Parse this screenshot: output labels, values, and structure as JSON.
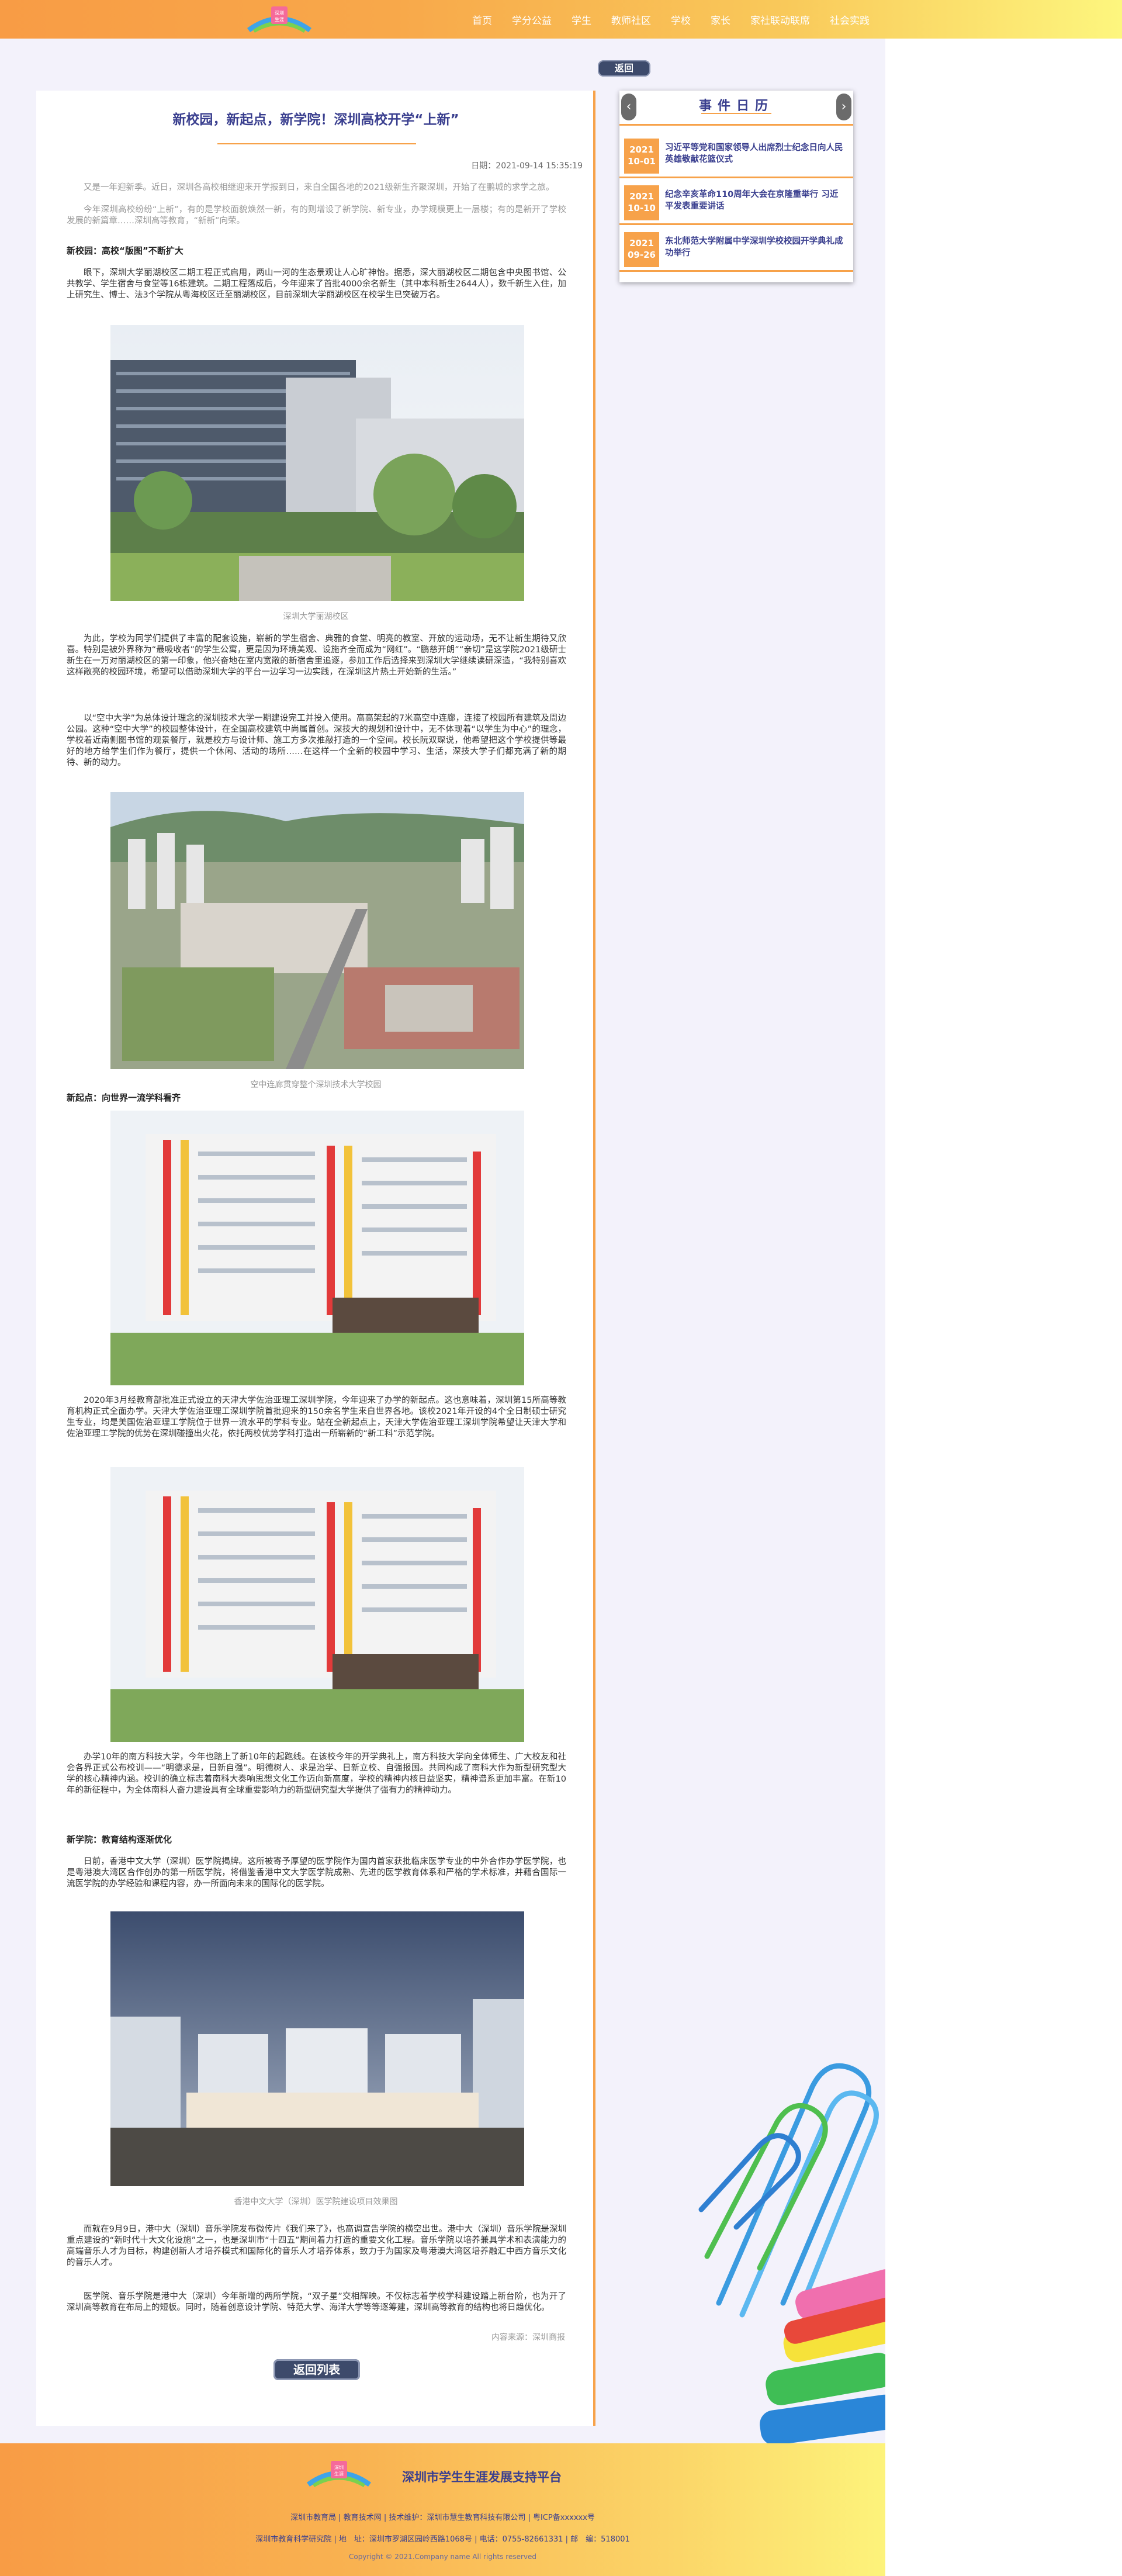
{
  "header": {
    "nav": [
      "首页",
      "学分公益",
      "学生",
      "教师社区",
      "学校",
      "家长",
      "家社联动联席",
      "社会实践"
    ]
  },
  "back_top": "返回",
  "article": {
    "title": "新校园，新起点，新学院！深圳高校开学“上新”",
    "date": "日期：2021-09-14 15:35:19",
    "intro1": "又是一年迎新季。近日，深圳各高校相继迎来开学报到日，来自全国各地的2021级新生齐聚深圳，开始了在鹏城的求学之旅。",
    "intro2": "今年深圳高校纷纷“上新”，有的是学校面貌焕然一新，有的则增设了新学院、新专业，办学规模更上一层楼；有的是新开了学校发展的新篇章……深圳高等教育，“新新”向荣。",
    "sub1": "新校园：高校“版图”不断扩大",
    "p1": "眼下，深圳大学丽湖校区二期工程正式启用，两山一河的生态景观让人心旷神怡。据悉，深大丽湖校区二期包含中央图书馆、公共教学、学生宿舍与食堂等16栋建筑。二期工程落成后，今年迎来了首批4000余名新生（其中本科新生2644人），数千新生入住，加上研究生、博士、法3个学院从粤海校区迁至丽湖校区，目前深圳大学丽湖校区在校学生已突破万名。",
    "cap1": "深圳大学丽湖校区",
    "p2": "为此，学校为同学们提供了丰富的配套设施，崭新的学生宿舍、典雅的食堂、明亮的教室、开放的运动场，无不让新生期待又欣喜。特别是被外界称为“最吸收者”的学生公寓，更是因为环境美观、设施齐全而成为“网红”。“鹏慈开朗”“亲切”是这学院2021级研士新生在一万对丽湖校区的第一印象，他兴奋地在室内宽敞的新宿舍里追逐，参加工作后选择来到深圳大学继续读研深造，“我特别喜欢这样敞亮的校园环境，希望可以借助深圳大学的平台一边学习一边实践，在深圳这片热土开始新的生活。”",
    "p3": "以“空中大学”为总体设计理念的深圳技术大学一期建设完工并投入使用。高高架起的7米高空中连廊，连接了校园所有建筑及周边公园。这种“空中大学”的校园整体设计，在全国高校建筑中尚属首创。深技大的规划和设计中，无不体现着“以学生为中心”的理念，学校着近南侧图书馆的观景餐厅，就是校方与设计师、施工方多次推敲打造的一个空间。校长阮双琛说，他希望把这个学校提供等最好的地方给学生们作为餐厅，提供一个休闲、活动的场所……在这样一个全新的校园中学习、生活，深技大学子们都充满了新的期待、新的动力。",
    "cap2": "空中连廊贯穿整个深圳技术大学校园",
    "sub2": "新起点：向世界一流学科看齐",
    "p4": "2020年3月经教育部批准正式设立的天津大学佐治亚理工深圳学院，今年迎来了办学的新起点。这也意味着，深圳第15所高等教育机构正式全面办学。天津大学佐治亚理工深圳学院首批迎来的150余名学生来自世界各地。该校2021年开设的4个全日制硕士研究生专业，均是美国佐治亚理工学院位于世界一流水平的学科专业。站在全新起点上，天津大学佐治亚理工深圳学院希望让天津大学和佐治亚理工学院的优势在深圳碰撞出火花，依托两校优势学科打造出一所崭新的“新工科”示范学院。",
    "p5": "办学10年的南方科技大学，今年也踏上了新10年的起跑线。在该校今年的开学典礼上，南方科技大学向全体师生、广大校友和社会各界正式公布校训——“明德求是，日新自强”。明德树人、求是治学、日新立校、自强报国。共同构成了南科大作为新型研究型大学的核心精神内涵。校训的确立标志着南科大奏响思想文化工作迈向新高度，学校的精神内核日益坚实，精神谱系更加丰富。在新10年的新征程中，为全体南科人奋力建设具有全球重要影响力的新型研究型大学提供了强有力的精神动力。",
    "sub3": "新学院：教育结构逐渐优化",
    "p6": "日前，香港中文大学（深圳）医学院揭牌。这所被寄予厚望的医学院作为国内首家获批临床医学专业的中外合作办学医学院，也是粤港澳大湾区合作创办的第一所医学院，将借鉴香港中文大学医学院成熟、先进的医学教育体系和严格的学术标准，并藉合国际一流医学院的办学经验和课程内容，办一所面向未来的国际化的医学院。",
    "cap3": "香港中文大学（深圳）医学院建设项目效果图",
    "p7": "而就在9月9日，港中大（深圳）音乐学院发布微传片《我们来了》，也高调宣告学院的横空出世。港中大（深圳）音乐学院是深圳重点建设的“新时代十大文化设施”之一，也是深圳市“十四五”期间着力打造的重要文化工程。音乐学院以培养兼具学术和表演能力的高端音乐人才为目标，构建创新人才培养模式和国际化的音乐人才培养体系，致力于为国家及粤港澳大湾区培养融汇中西方音乐文化的音乐人才。",
    "p8": "医学院、音乐学院是港中大（深圳）今年新增的两所学院，“双子星”交相辉映。不仅标志着学校学科建设踏上新台阶，也为开了深圳高等教育在布局上的短板。同时，随着创意设计学院、特范大学、海洋大学等等逐筹建，深圳高等教育的结构也将日趋优化。",
    "source": "内容来源：深圳商报",
    "back_list": "返回列表"
  },
  "events": {
    "title": "事件日历",
    "prev_icon": "‹",
    "next_icon": "›",
    "items": [
      {
        "date": "2021\n10-01",
        "text": "习近平等党和国家领导人出席烈士纪念日向人民英雄敬献花篮仪式"
      },
      {
        "date": "2021\n10-10",
        "text": "纪念辛亥革命110周年大会在京隆重举行 习近平发表重要讲话"
      },
      {
        "date": "2021\n09-26",
        "text": "东北师范大学附属中学深圳学校校园开学典礼成功举行"
      }
    ]
  },
  "footer": {
    "platform_name": "深圳市学生生涯发展支持平台",
    "links": "深圳市教育局 | 教育技术网 | 技术维护：深圳市慧生教育科技有限公司 | 粤ICP备xxxxxx号",
    "contact": "深圳市教育科学研究院  |  地　址：深圳市罗湖区园岭西路1068号  |  电话：0755-82661331  |  邮　编：518001",
    "copyright": "Copyright © 2021.Company name All rights reserved"
  }
}
